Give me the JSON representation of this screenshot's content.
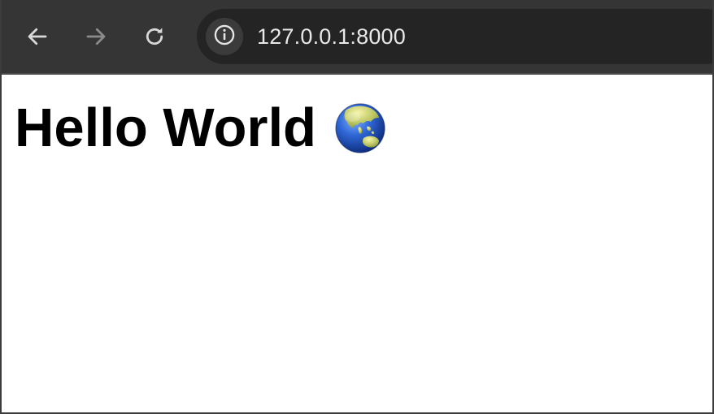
{
  "browser": {
    "url": "127.0.0.1:8000",
    "buttons": {
      "back_icon": "arrow-left-icon",
      "forward_icon": "arrow-right-icon",
      "reload_icon": "reload-icon",
      "site_info_icon": "info-icon"
    },
    "colors": {
      "toolbar": "#353535",
      "omnibox": "#242424",
      "icon_active": "#d9d9d9",
      "icon_disabled": "#8a8a8a"
    }
  },
  "page": {
    "heading": "Hello World",
    "heading_icon": "globe-asia-australia-icon"
  }
}
